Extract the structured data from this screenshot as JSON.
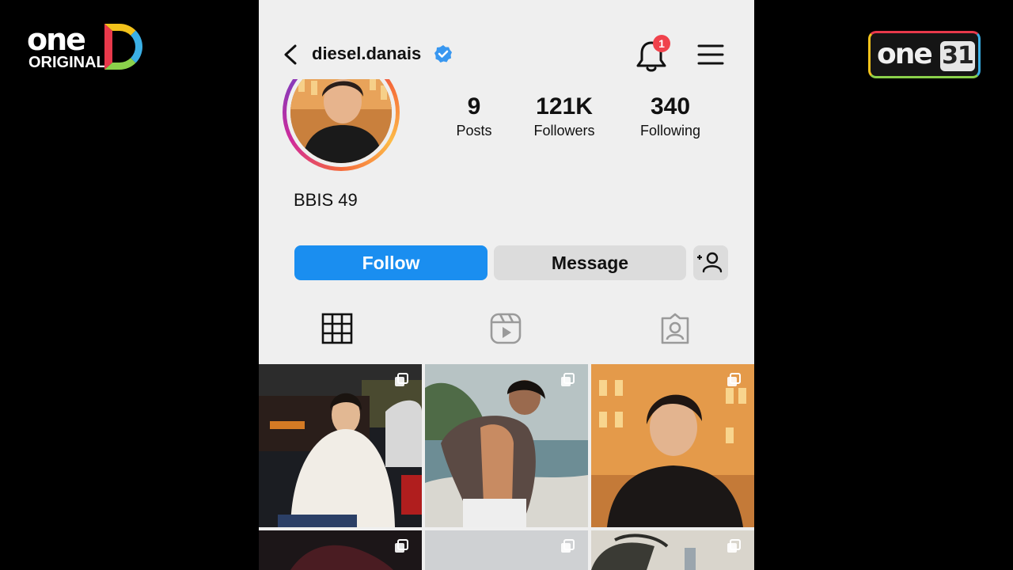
{
  "overlay": {
    "left_logo": {
      "word": "one",
      "sub": "ORIGINAL",
      "letter": "D"
    },
    "right_logo": {
      "word": "one",
      "channel": "31"
    }
  },
  "profile": {
    "username": "diesel.danais",
    "verified": true,
    "notification_count": "1",
    "bio": "BBIS 49",
    "stats": [
      {
        "value": "9",
        "label": "Posts"
      },
      {
        "value": "121K",
        "label": "Followers"
      },
      {
        "value": "340",
        "label": "Following"
      }
    ]
  },
  "actions": {
    "follow_label": "Follow",
    "message_label": "Message"
  },
  "tabs": [
    {
      "icon": "grid-icon",
      "active": true
    },
    {
      "icon": "reels-icon",
      "active": false
    },
    {
      "icon": "tagged-icon",
      "active": false
    }
  ],
  "colors": {
    "follow_blue": "#1a8ef0",
    "badge_red": "#f0424c",
    "verified_blue": "#3897f0"
  }
}
